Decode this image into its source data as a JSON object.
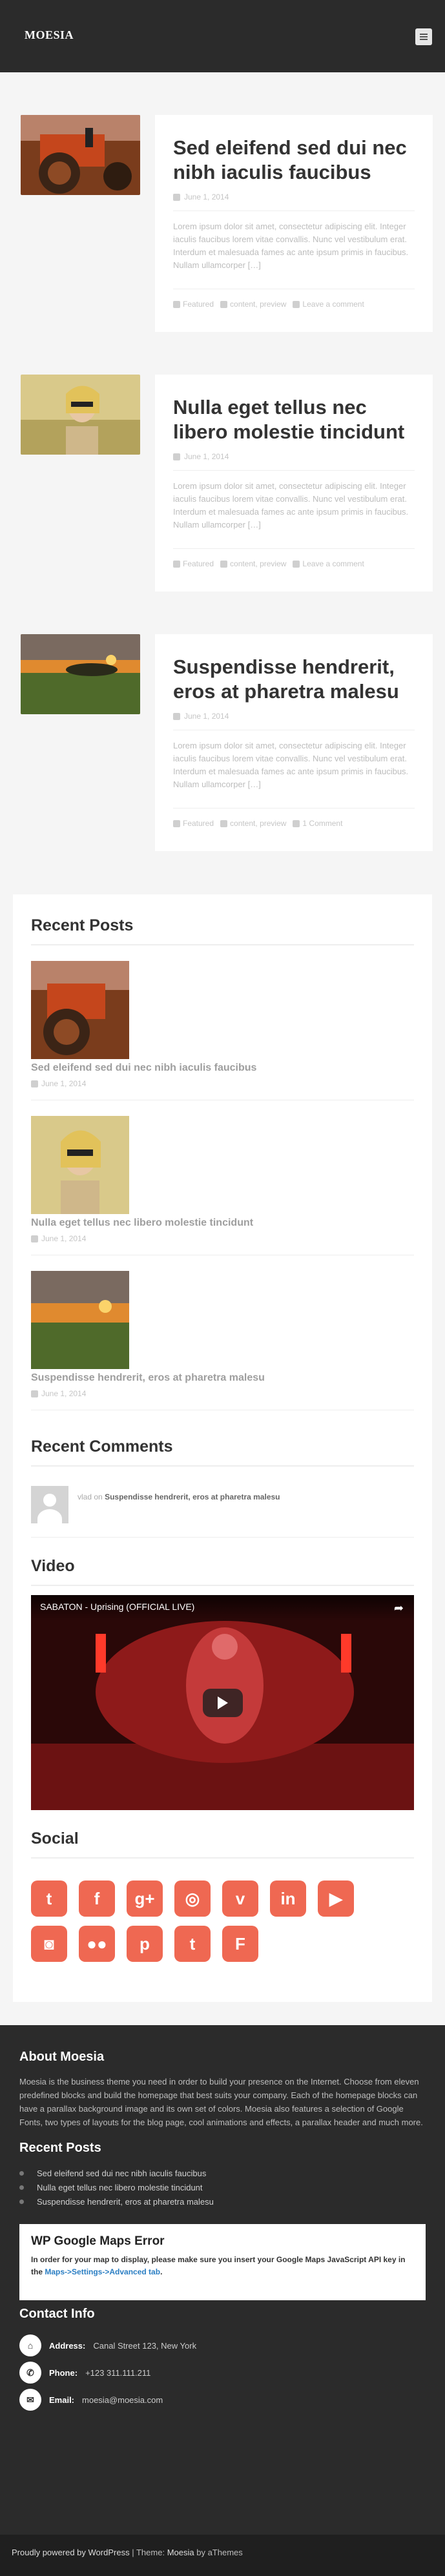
{
  "site": {
    "title": "MOESIA"
  },
  "posts": [
    {
      "title": "Sed eleifend sed dui nec nibh iaculis faucibus",
      "date": "June 1, 2014",
      "excerpt": "Lorem ipsum dolor sit amet, consectetur adipiscing elit. Integer iaculis faucibus lorem vitae convallis. Nunc vel vestibulum erat. Interdum et malesuada fames ac ante ipsum primis in faucibus. Nullam ullamcorper […]",
      "category": "Featured",
      "tags": "content, preview",
      "comments": "Leave a comment"
    },
    {
      "title": "Nulla eget tellus nec libero molestie tincidunt",
      "date": "June 1, 2014",
      "excerpt": "Lorem ipsum dolor sit amet, consectetur adipiscing elit. Integer iaculis faucibus lorem vitae convallis. Nunc vel vestibulum erat. Interdum et malesuada fames ac ante ipsum primis in faucibus. Nullam ullamcorper […]",
      "category": "Featured",
      "tags": "content, preview",
      "comments": "Leave a comment"
    },
    {
      "title": "Suspendisse hendrerit, eros at pharetra malesu",
      "date": "June 1, 2014",
      "excerpt": "Lorem ipsum dolor sit amet, consectetur adipiscing elit. Integer iaculis faucibus lorem vitae convallis. Nunc vel vestibulum erat. Interdum et malesuada fames ac ante ipsum primis in faucibus. Nullam ullamcorper […]",
      "category": "Featured",
      "tags": "content, preview",
      "comments": "1 Comment"
    }
  ],
  "recent_posts": {
    "title": "Recent Posts",
    "items": [
      {
        "title": "Sed eleifend sed dui nec nibh iaculis faucibus",
        "date": "June 1, 2014"
      },
      {
        "title": "Nulla eget tellus nec libero molestie tincidunt",
        "date": "June 1, 2014"
      },
      {
        "title": "Suspendisse hendrerit, eros at pharetra malesu",
        "date": "June 1, 2014"
      }
    ]
  },
  "recent_comments": {
    "title": "Recent Comments",
    "author": "vlad",
    "on": "on",
    "post": "Suspendisse hendrerit, eros at pharetra malesu"
  },
  "video": {
    "title": "Video",
    "video_title": "SABATON - Uprising (OFFICIAL LIVE)"
  },
  "social": {
    "title": "Social",
    "icons": [
      "twitter-icon",
      "facebook-icon",
      "google-plus-icon",
      "dribbble-icon",
      "vimeo-icon",
      "linkedin-icon",
      "youtube-icon",
      "instagram-icon",
      "flickr-icon",
      "pinterest-icon",
      "tumblr-icon",
      "foursquare-icon"
    ],
    "glyphs": [
      "t",
      "f",
      "g+",
      "◎",
      "v",
      "in",
      "▶",
      "◙",
      "●●",
      "p",
      "t",
      "F"
    ],
    "accent": "#ef6852"
  },
  "footer": {
    "about_title": "About Moesia",
    "about_text": "Moesia is the business theme you need in order to build your presence on the Internet. Choose from eleven predefined blocks and build the homepage that best suits your company. Each of the homepage blocks can have a parallax background image and its own set of colors. Moesia also features a selection of Google Fonts, two types of layouts for the blog page, cool animations and effects, a parallax header and much more.",
    "recent_title": "Recent Posts",
    "recent": [
      "Sed eleifend sed dui nec nibh iaculis faucibus",
      "Nulla eget tellus nec libero molestie tincidunt",
      "Suspendisse hendrerit, eros at pharetra malesu"
    ],
    "map_error_title": "WP Google Maps Error",
    "map_error_text": "In order for your map to display, please make sure you insert your Google Maps JavaScript API key in the",
    "map_error_link": "Maps->Settings->Advanced tab",
    "contact_title": "Contact Info",
    "address_label": "Address:",
    "address": "Canal Street 123, New York",
    "phone_label": "Phone:",
    "phone": "+123 311.111.211",
    "email_label": "Email:",
    "email": "moesia@moesia.com"
  },
  "credits": {
    "powered": "Proudly powered by WordPress",
    "sep": "|",
    "theme": "Theme:",
    "theme_name": "Moesia",
    "by": "by aThemes"
  }
}
